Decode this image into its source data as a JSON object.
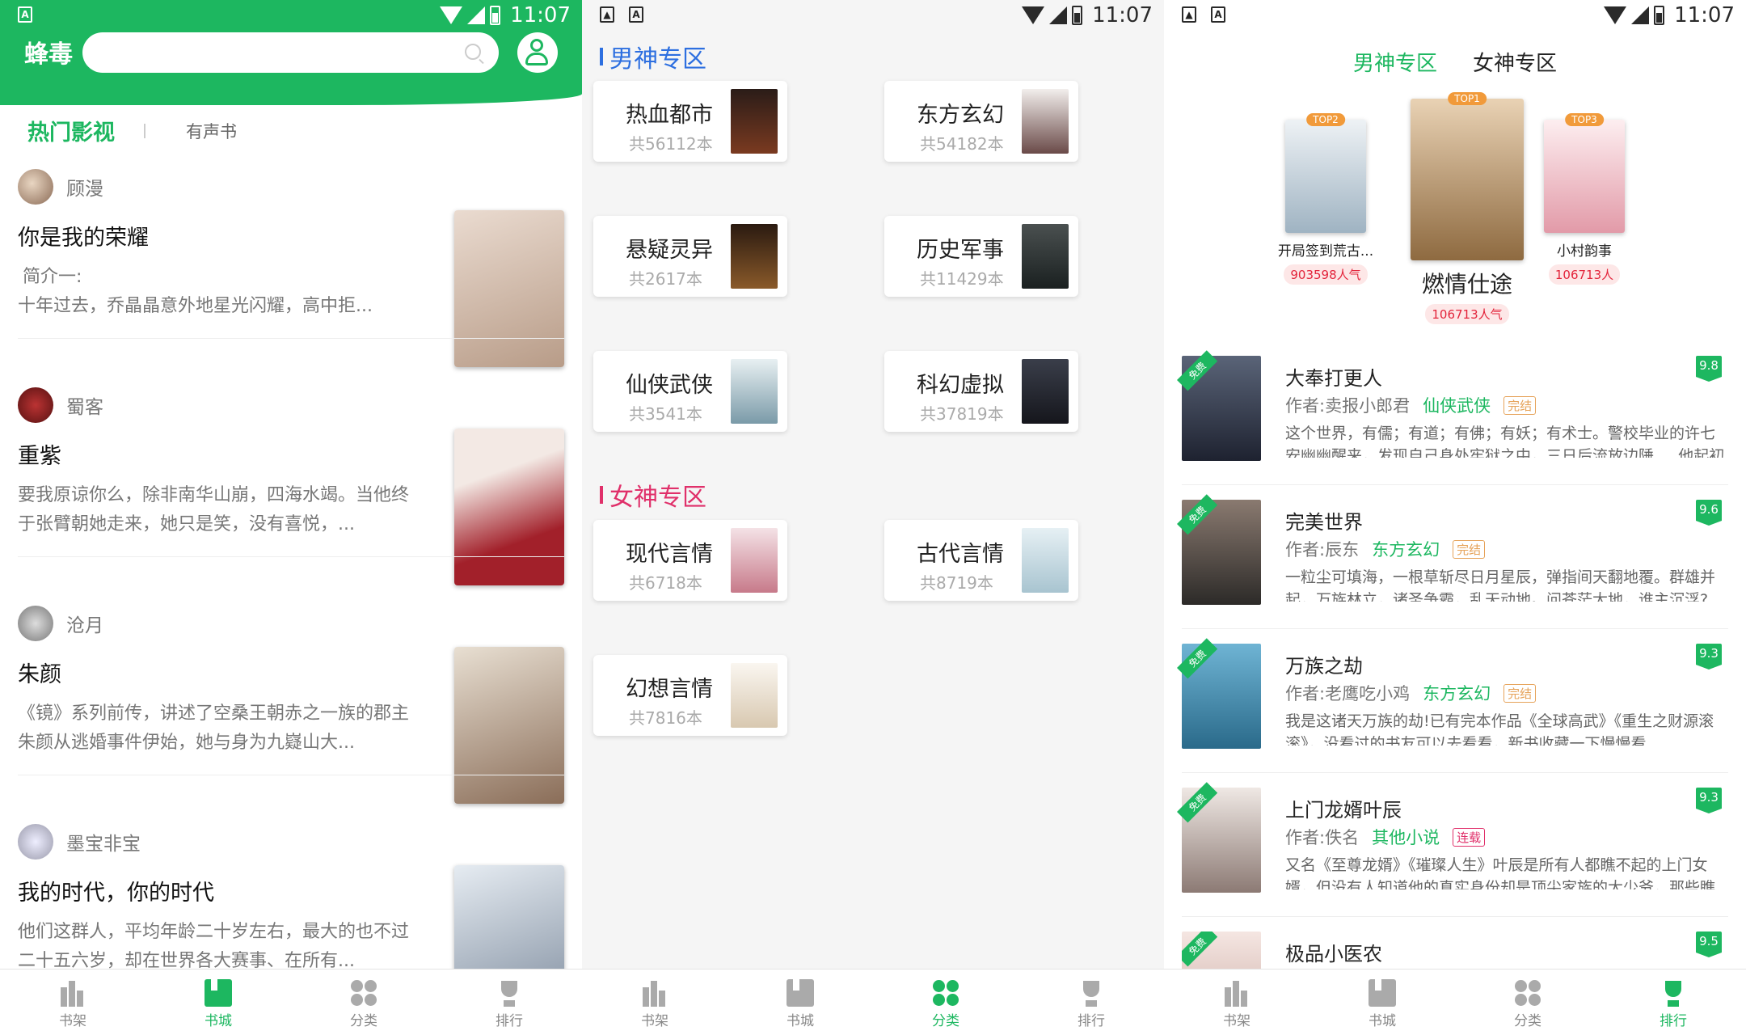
{
  "status_bar": {
    "time": "11:07"
  },
  "screen1": {
    "logo": "蜂毒",
    "tabs": {
      "active": "热门影视",
      "other": "有声书"
    },
    "feed": [
      {
        "author": "顾漫",
        "title": "你是我的荣耀",
        "desc": "简介一:\n十年过去，乔晶晶意外地星光闪耀，高中拒..."
      },
      {
        "author": "蜀客",
        "title": "重紫",
        "desc": "要我原谅你么，除非南华山崩，四海水竭。当他终于张臂朝她走来，她只是笑，没有喜悦，..."
      },
      {
        "author": "沧月",
        "title": "朱颜",
        "desc": "《镜》系列前传，讲述了空桑王朝赤之一族的郡主朱颜从逃婚事件伊始，她与身为九嶷山大..."
      },
      {
        "author": "墨宝非宝",
        "title": "我的时代，你的时代",
        "desc": "他们这群人，平均年龄二十岁左右，最大的也不过二十五六岁，却在世界各大赛事、在所有..."
      }
    ],
    "cover_colors": [
      "#d9c2b0",
      "#a2202a",
      "#c9b39b",
      "#c7cdd6"
    ]
  },
  "nav": {
    "items": [
      "书架",
      "书城",
      "分类",
      "排行"
    ]
  },
  "screen2": {
    "male_title": "男神专区",
    "female_title": "女神专区",
    "male_color": "#2d6fe0",
    "female_color": "#e0306a",
    "male_cats": [
      {
        "name": "热血都市",
        "count": "共56112本",
        "color": "#3a2a22"
      },
      {
        "name": "东方玄幻",
        "count": "共54182本",
        "color": "#e8e3e0"
      },
      {
        "name": "悬疑灵异",
        "count": "共2617本",
        "color": "#4a2e18"
      },
      {
        "name": "历史军事",
        "count": "共11429本",
        "color": "#2e3a3a"
      },
      {
        "name": "仙侠武侠",
        "count": "共3541本",
        "color": "#a9c3cf"
      },
      {
        "name": "科幻虚拟",
        "count": "共37819本",
        "color": "#2a2c35"
      }
    ],
    "female_cats": [
      {
        "name": "现代言情",
        "count": "共6718本",
        "color": "#e9c9cf"
      },
      {
        "name": "古代言情",
        "count": "共8719本",
        "color": "#cfe1ea"
      },
      {
        "name": "幻想言情",
        "count": "共7816本",
        "color": "#f2ece4"
      }
    ]
  },
  "screen3": {
    "tabs": {
      "active": "男神专区",
      "other": "女神专区"
    },
    "podium": [
      {
        "rank": "TOP2",
        "name": "开局签到荒古...",
        "hot": "903598人气",
        "color": "#d6e2ea"
      },
      {
        "rank": "TOP1",
        "name": "燃情仕途",
        "hot": "106713人气",
        "color": "#c9a27a"
      },
      {
        "rank": "TOP3",
        "name": "小村韵事",
        "hot": "106713人",
        "color": "#f3c7cf"
      }
    ],
    "free_label": "免费",
    "author_prefix": "作者:",
    "list": [
      {
        "title": "大奉打更人",
        "author": "卖报小郎君",
        "genre": "仙侠武侠",
        "status": "完结",
        "score": "9.8",
        "desc": "这个世界，有儒；有道；有佛；有妖；有术士。警校毕业的许七安幽幽醒来，发现自己身处牢狱之中，三日后流放边陲.....他起初的",
        "color": "#3d4657"
      },
      {
        "title": "完美世界",
        "author": "辰东",
        "genre": "东方玄幻",
        "status": "完结",
        "score": "9.6",
        "desc": "一粒尘可填海，一根草斩尽日月星辰，弹指间天翻地覆。群雄并起，万族林立，诸圣争霸，乱天动地。问苍茫大地，谁主沉浮?",
        "color": "#5a5550"
      },
      {
        "title": "万族之劫",
        "author": "老鹰吃小鸡",
        "genre": "东方玄幻",
        "status": "完结",
        "score": "9.3",
        "desc": "我是这诸天万族的劫!已有完本作品《全球高武》《重生之财源滚滚》，没看过的书友可以去看看，新书收藏一下慢慢看",
        "color": "#3f8bb0"
      },
      {
        "title": "上门龙婿叶辰",
        "author": "佚名",
        "genre": "其他小说",
        "status": "连载",
        "score": "9.3",
        "desc": "又名《至尊龙婿》《璀璨人生》叶辰是所有人都瞧不起的上门女婿，但没有人知道他的真实身份却是顶尖家族的大少爷，那些瞧",
        "color": "#d9d0cc"
      },
      {
        "title": "极品小医农",
        "author": "",
        "genre": "",
        "status": "",
        "score": "9.5",
        "desc": "",
        "color": "#e7d5d0"
      }
    ]
  }
}
